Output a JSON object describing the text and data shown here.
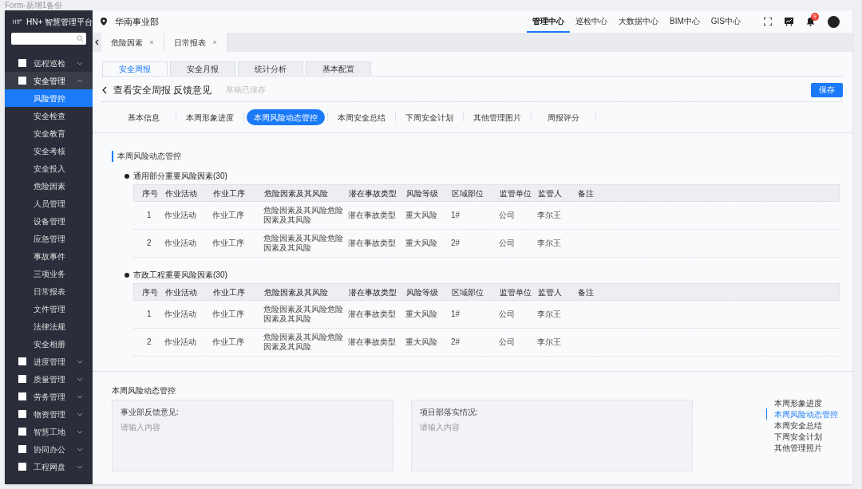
{
  "frame_label": "Form-新增1备份",
  "sidebar": {
    "brand": "HN+ 智慧管理平台",
    "menu": [
      {
        "label": "远程巡检",
        "expanded": false
      },
      {
        "label": "安全管理",
        "expanded": true,
        "children": [
          {
            "label": "风险管控",
            "selected": true
          },
          {
            "label": "安全检查",
            "selected": false
          },
          {
            "label": "安全教育",
            "selected": false
          },
          {
            "label": "安全考核",
            "selected": false
          },
          {
            "label": "安全投入",
            "selected": false
          },
          {
            "label": "危险因素",
            "selected": false
          },
          {
            "label": "人员管理",
            "selected": false
          },
          {
            "label": "设备管理",
            "selected": false
          },
          {
            "label": "应急管理",
            "selected": false
          },
          {
            "label": "事故事件",
            "selected": false
          },
          {
            "label": "三项业务",
            "selected": false
          },
          {
            "label": "日常报表",
            "selected": false
          },
          {
            "label": "文件管理",
            "selected": false
          },
          {
            "label": "法律法规",
            "selected": false
          },
          {
            "label": "安全相册",
            "selected": false
          }
        ]
      },
      {
        "label": "进度管理",
        "expanded": false
      },
      {
        "label": "质量管理",
        "expanded": false
      },
      {
        "label": "劳务管理",
        "expanded": false
      },
      {
        "label": "物资管理",
        "expanded": false
      },
      {
        "label": "智慧工地",
        "expanded": false
      },
      {
        "label": "协同办公",
        "expanded": false
      },
      {
        "label": "工程网盘",
        "expanded": false
      }
    ]
  },
  "header": {
    "location": "华南事业部",
    "nav": [
      {
        "label": "管理中心",
        "selected": true
      },
      {
        "label": "巡检中心",
        "selected": false
      },
      {
        "label": "大数据中心",
        "selected": false
      },
      {
        "label": "BIM中心",
        "selected": false
      },
      {
        "label": "GIS中心",
        "selected": false
      }
    ],
    "badge": "9"
  },
  "open_tabs": [
    {
      "label": "危险因素"
    },
    {
      "label": "日常报表"
    }
  ],
  "module_tabs": [
    {
      "label": "安全周报",
      "selected": true
    },
    {
      "label": "安全月报",
      "selected": false
    },
    {
      "label": "统计分析",
      "selected": false
    },
    {
      "label": "基本配置",
      "selected": false
    }
  ],
  "page": {
    "title": "查看安全周报 反馈意见",
    "status": "草稿已保存",
    "save": "保存"
  },
  "section_tabs": [
    {
      "label": "基本信息",
      "selected": false
    },
    {
      "label": "本周形象进度",
      "selected": false
    },
    {
      "label": "本周风险动态管控",
      "selected": true
    },
    {
      "label": "本周安全总结",
      "selected": false
    },
    {
      "label": "下周安全计划",
      "selected": false
    },
    {
      "label": "其他管理图片",
      "selected": false
    },
    {
      "label": "周报评分",
      "selected": false
    }
  ],
  "section_title": "本周风险动态管控",
  "tables": [
    {
      "title": "通用部分重要风险因素(30)",
      "columns": [
        "序号",
        "作业活动",
        "作业工序",
        "危险因素及其风险",
        "潜在事故类型",
        "风险等级",
        "区域部位",
        "监管单位",
        "监管人",
        "备注"
      ],
      "rows": [
        [
          "1",
          "作业活动",
          "作业工序",
          "危险因素及其风险危险因素及其风险",
          "潜在事故类型",
          "重大风险",
          "1#",
          "公司",
          "李尔王"
        ],
        [
          "2",
          "作业活动",
          "作业工序",
          "危险因素及其风险危险因素及其风险",
          "潜在事故类型",
          "重大风险",
          "2#",
          "公司",
          "李尔王"
        ]
      ]
    },
    {
      "title": "市政工程重要风险因素(30)",
      "columns": [
        "序号",
        "作业活动",
        "作业工序",
        "危险因素及其风险",
        "潜在事故类型",
        "风险等级",
        "区域部位",
        "监管单位",
        "监管人",
        "备注"
      ],
      "rows": [
        [
          "1",
          "作业活动",
          "作业工序",
          "危险因素及其风险危险因素及其风险",
          "潜在事故类型",
          "重大风险",
          "1#",
          "公司",
          "李尔王"
        ],
        [
          "2",
          "作业活动",
          "作业工序",
          "危险因素及其风险危险因素及其风险",
          "潜在事故类型",
          "重大风险",
          "2#",
          "公司",
          "李尔王"
        ]
      ]
    }
  ],
  "feedback": {
    "title": "本周风险动态管控",
    "fields": [
      {
        "label": "事业部反馈意见:",
        "placeholder": "请输入内容"
      },
      {
        "label": "项目部落实情况:",
        "placeholder": "请输入内容"
      }
    ]
  },
  "anchor_nav": [
    {
      "label": "本周形象进度",
      "selected": false
    },
    {
      "label": "本周风险动态管控",
      "selected": true
    },
    {
      "label": "本周安全总结",
      "selected": false
    },
    {
      "label": "下周安全计划",
      "selected": false
    },
    {
      "label": "其他管理照片",
      "selected": false
    }
  ]
}
